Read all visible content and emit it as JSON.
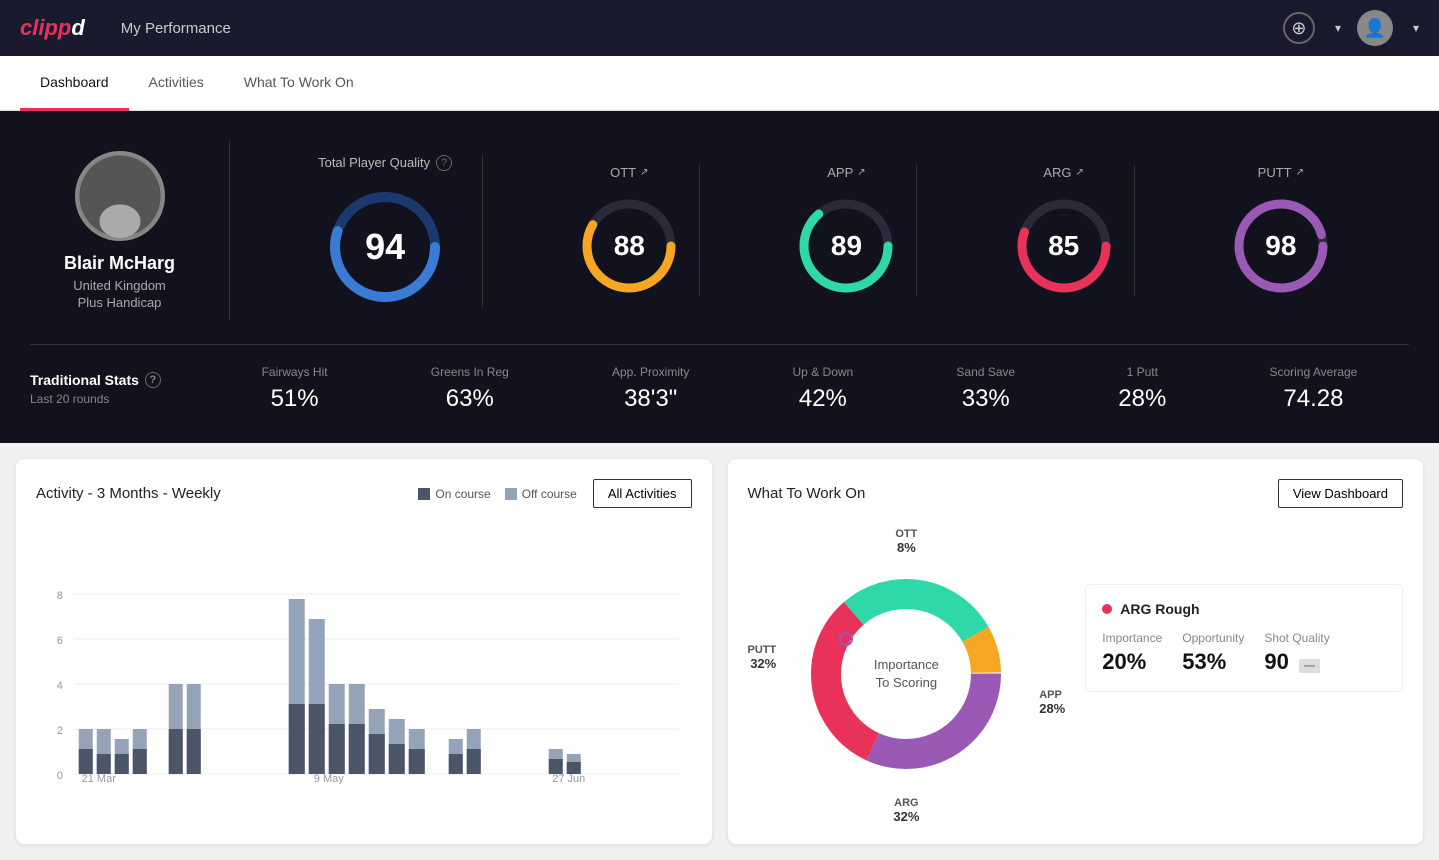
{
  "app": {
    "logo": "clippd",
    "nav_title": "My Performance"
  },
  "tabs": [
    {
      "label": "Dashboard",
      "active": true
    },
    {
      "label": "Activities",
      "active": false
    },
    {
      "label": "What To Work On",
      "active": false
    }
  ],
  "player": {
    "name": "Blair McHarg",
    "country": "United Kingdom",
    "handicap": "Plus Handicap",
    "avatar_emoji": "🧍"
  },
  "quality": {
    "label": "Total Player Quality",
    "main_score": 94,
    "scores": [
      {
        "label": "OTT",
        "value": 88,
        "color": "#f5a623",
        "trend": "↗"
      },
      {
        "label": "APP",
        "value": 89,
        "color": "#2ed8a8",
        "trend": "↗"
      },
      {
        "label": "ARG",
        "value": 85,
        "color": "#e8325a",
        "trend": "↗"
      },
      {
        "label": "PUTT",
        "value": 98,
        "color": "#9b59b6",
        "trend": "↗"
      }
    ]
  },
  "trad_stats": {
    "label": "Traditional Stats",
    "sub_label": "Last 20 rounds",
    "items": [
      {
        "label": "Fairways Hit",
        "value": "51%"
      },
      {
        "label": "Greens In Reg",
        "value": "63%"
      },
      {
        "label": "App. Proximity",
        "value": "38'3\""
      },
      {
        "label": "Up & Down",
        "value": "42%"
      },
      {
        "label": "Sand Save",
        "value": "33%"
      },
      {
        "label": "1 Putt",
        "value": "28%"
      },
      {
        "label": "Scoring Average",
        "value": "74.28"
      }
    ]
  },
  "activity_chart": {
    "title": "Activity - 3 Months - Weekly",
    "legend": [
      {
        "label": "On course",
        "color": "#4a5568"
      },
      {
        "label": "Off course",
        "color": "#94a3b8"
      }
    ],
    "all_activities_label": "All Activities",
    "x_labels": [
      "21 Mar",
      "9 May",
      "27 Jun"
    ],
    "y_labels": [
      "0",
      "2",
      "4",
      "6",
      "8"
    ]
  },
  "work_on": {
    "title": "What To Work On",
    "view_dashboard_label": "View Dashboard",
    "donut_center": "Importance\nTo Scoring",
    "segments": [
      {
        "label": "OTT",
        "percent": "8%",
        "color": "#f5a623"
      },
      {
        "label": "APP",
        "percent": "28%",
        "color": "#2ed8a8"
      },
      {
        "label": "ARG",
        "percent": "32%",
        "color": "#e8325a"
      },
      {
        "label": "PUTT",
        "percent": "32%",
        "color": "#9b59b6"
      }
    ],
    "detail": {
      "title": "ARG Rough",
      "dot_color": "#e8325a",
      "metrics": [
        {
          "label": "Importance",
          "value": "20%"
        },
        {
          "label": "Opportunity",
          "value": "53%"
        },
        {
          "label": "Shot Quality",
          "value": "90",
          "badge": "—"
        }
      ]
    }
  }
}
